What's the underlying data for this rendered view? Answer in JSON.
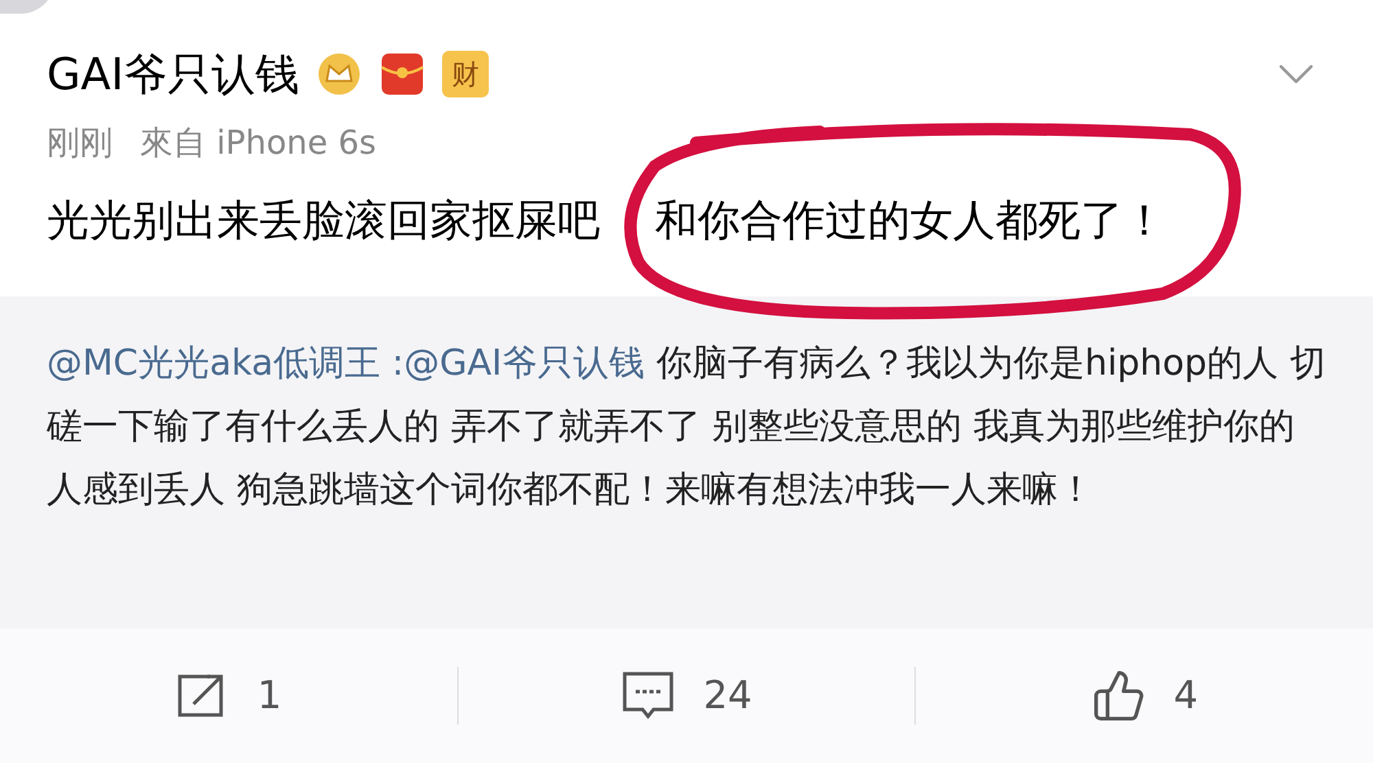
{
  "post": {
    "author": "GAI爷只认钱",
    "badge_text": "财",
    "time": "刚刚",
    "source": "來自 iPhone 6s",
    "text": "光光别出来丢脸滚回家抠屎吧",
    "text_highlighted": "和你合作过的女人都死了！"
  },
  "repost": {
    "author": "@MC光光aka低调王",
    "separator": " :",
    "mention": "@GAI爷只认钱",
    "text": " 你脑子有病么？我以为你是hiphop的人 切磋一下输了有什么丢人的 弄不了就弄不了 别整些没意思的 我真为那些维护你的人感到丢人 狗急跳墙这个词你都不配！来嘛有想法冲我一人来嘛！"
  },
  "actions": [
    {
      "kind": "share",
      "count": "1"
    },
    {
      "kind": "comment",
      "count": "24"
    },
    {
      "kind": "like",
      "count": "4"
    }
  ]
}
